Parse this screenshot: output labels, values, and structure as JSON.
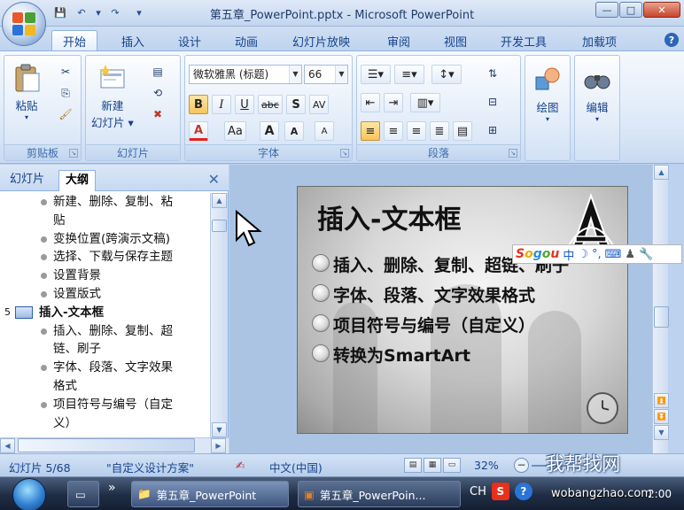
{
  "window": {
    "title": "第五章_PowerPoint.pptx - Microsoft PowerPoint",
    "controls": [
      "—",
      "□",
      "✕"
    ]
  },
  "qat": [
    "💾",
    "↶",
    "▾",
    "↷",
    "▾"
  ],
  "ribbon_tabs": [
    "开始",
    "插入",
    "设计",
    "动画",
    "幻灯片放映",
    "审阅",
    "视图",
    "开发工具",
    "加载项"
  ],
  "help_label": "?",
  "ribbon": {
    "clipboard": {
      "label": "剪贴板",
      "paste": "粘贴"
    },
    "slides": {
      "label": "幻灯片",
      "new_slide_line1": "新建",
      "new_slide_line2": "幻灯片 ▾"
    },
    "font": {
      "label": "字体",
      "font_name": "微软雅黑 (标题)",
      "font_size": "66",
      "bold": "B",
      "italic": "I",
      "underline": "U",
      "strike": "abc",
      "shadow": "S",
      "spacing": "AV",
      "font_color": "A",
      "case": "Aa",
      "grow": "A",
      "shrink": "A",
      "clear": "A"
    },
    "paragraph": {
      "label": "段落"
    },
    "drawing": {
      "label": "绘图"
    },
    "editing": {
      "label": "编辑"
    }
  },
  "left_pane": {
    "tabs": [
      "幻灯片",
      "大纲"
    ],
    "active_tab": "大纲",
    "close": "✕",
    "outline": [
      {
        "type": "bullet",
        "text": "新建、删除、复制、粘"
      },
      {
        "type": "cont",
        "text": "贴"
      },
      {
        "type": "bullet",
        "text": "变换位置(跨演示文稿)"
      },
      {
        "type": "bullet",
        "text": "选择、下载与保存主题"
      },
      {
        "type": "bullet",
        "text": "设置背景"
      },
      {
        "type": "bullet",
        "text": "设置版式"
      },
      {
        "type": "slide",
        "num": "5",
        "text": "插入-文本框"
      },
      {
        "type": "bullet",
        "text": "插入、删除、复制、超"
      },
      {
        "type": "cont",
        "text": "链、刷子"
      },
      {
        "type": "bullet",
        "text": "字体、段落、文字效果"
      },
      {
        "type": "cont",
        "text": "格式"
      },
      {
        "type": "bullet",
        "text": "项目符号与编号（自定"
      },
      {
        "type": "cont",
        "text": "义）"
      }
    ]
  },
  "slide": {
    "title": "插入-文本框",
    "items": [
      "插入、删除、复制、超链、刷子",
      "字体、段落、文字效果格式",
      "项目符号与编号（自定义）",
      "转换为SmartArt"
    ]
  },
  "sogou": {
    "logo_letters": [
      "S",
      "o",
      "g",
      "o",
      "u"
    ],
    "mode": "中",
    "icons": [
      "☽",
      "°,",
      "⌨",
      "♟",
      "🔧"
    ]
  },
  "status": {
    "slide_counter": "幻灯片 5/68",
    "theme": "\"自定义设计方案\"",
    "language": "中文(中国)",
    "zoom": "32%"
  },
  "watermark": {
    "text": "我帮找网",
    "url": "wobangzhao.com"
  },
  "taskbar": {
    "items": [
      "第五章_PowerPoint",
      "第五章_PowerPoin..."
    ],
    "tray": {
      "lang": "CH",
      "s": "S",
      "q": "?",
      "time": "2:00"
    }
  }
}
